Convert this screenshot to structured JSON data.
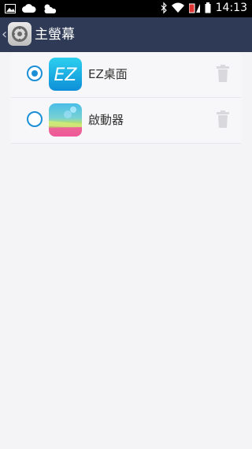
{
  "statusbar": {
    "time": "14:13"
  },
  "header": {
    "title": "主螢幕"
  },
  "launchers": [
    {
      "label": "EZ桌面",
      "icon_text": "EZ",
      "selected": true
    },
    {
      "label": "啟動器",
      "selected": false
    }
  ],
  "colors": {
    "accent": "#1d8fd6",
    "header_bg": "#2f3a56"
  }
}
